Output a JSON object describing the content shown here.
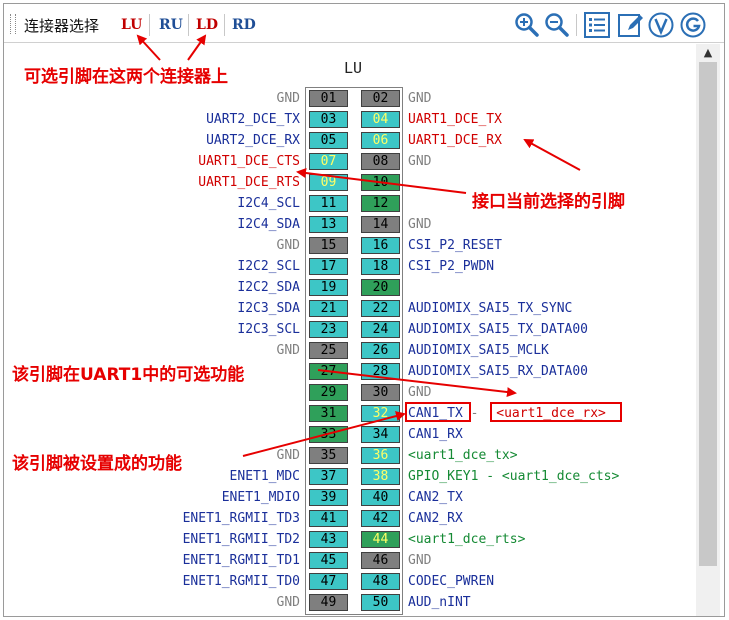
{
  "toolbar": {
    "label": "连接器选择",
    "connectors": [
      {
        "label": "LU",
        "color": "#c00000"
      },
      {
        "label": "RU",
        "color": "#1f4e96"
      },
      {
        "label": "LD",
        "color": "#c00000"
      },
      {
        "label": "RD",
        "color": "#1f4e96"
      }
    ],
    "icons": [
      "zoom-in-icon",
      "zoom-out-icon",
      "list-icon",
      "edit-icon",
      "v-circle-icon",
      "g-circle-icon"
    ]
  },
  "connector_title": "LU",
  "rows": [
    {
      "ln": "01",
      "lc": "gray",
      "lname": "GND",
      "lcolor": "gray",
      "rn": "02",
      "rc": "gray",
      "rname": "GND",
      "rcolor": "gray"
    },
    {
      "ln": "03",
      "lc": "teal",
      "lname": "UART2_DCE_TX",
      "lcolor": "blue",
      "rn": "04",
      "rc": "teal",
      "rhl": true,
      "rname": "UART1_DCE_TX",
      "rcolor": "red"
    },
    {
      "ln": "05",
      "lc": "teal",
      "lname": "UART2_DCE_RX",
      "lcolor": "blue",
      "rn": "06",
      "rc": "teal",
      "rhl": true,
      "rname": "UART1_DCE_RX",
      "rcolor": "red"
    },
    {
      "ln": "07",
      "lc": "teal",
      "lhl": true,
      "lname": "UART1_DCE_CTS",
      "lcolor": "red",
      "rn": "08",
      "rc": "gray",
      "rname": "GND",
      "rcolor": "gray"
    },
    {
      "ln": "09",
      "lc": "teal",
      "lhl": true,
      "lname": "UART1_DCE_RTS",
      "lcolor": "red",
      "rn": "10",
      "rc": "green",
      "rname": "",
      "rcolor": "gray"
    },
    {
      "ln": "11",
      "lc": "teal",
      "lname": "I2C4_SCL",
      "lcolor": "blue",
      "rn": "12",
      "rc": "green",
      "rname": "",
      "rcolor": "gray"
    },
    {
      "ln": "13",
      "lc": "teal",
      "lname": "I2C4_SDA",
      "lcolor": "blue",
      "rn": "14",
      "rc": "gray",
      "rname": "GND",
      "rcolor": "gray"
    },
    {
      "ln": "15",
      "lc": "gray",
      "lname": "GND",
      "lcolor": "gray",
      "rn": "16",
      "rc": "teal",
      "rname": "CSI_P2_RESET",
      "rcolor": "blue"
    },
    {
      "ln": "17",
      "lc": "teal",
      "lname": "I2C2_SCL",
      "lcolor": "blue",
      "rn": "18",
      "rc": "teal",
      "rname": "CSI_P2_PWDN",
      "rcolor": "blue"
    },
    {
      "ln": "19",
      "lc": "teal",
      "lname": "I2C2_SDA",
      "lcolor": "blue",
      "rn": "20",
      "rc": "green",
      "rname": "",
      "rcolor": "gray"
    },
    {
      "ln": "21",
      "lc": "teal",
      "lname": "I2C3_SDA",
      "lcolor": "blue",
      "rn": "22",
      "rc": "teal",
      "rname": "AUDIOMIX_SAI5_TX_SYNC",
      "rcolor": "blue"
    },
    {
      "ln": "23",
      "lc": "teal",
      "lname": "I2C3_SCL",
      "lcolor": "blue",
      "rn": "24",
      "rc": "teal",
      "rname": "AUDIOMIX_SAI5_TX_DATA00",
      "rcolor": "blue"
    },
    {
      "ln": "25",
      "lc": "gray",
      "lname": "GND",
      "lcolor": "gray",
      "rn": "26",
      "rc": "teal",
      "rname": "AUDIOMIX_SAI5_MCLK",
      "rcolor": "blue"
    },
    {
      "ln": "27",
      "lc": "green",
      "lname": "",
      "lcolor": "gray",
      "rn": "28",
      "rc": "teal",
      "rname": "AUDIOMIX_SAI5_RX_DATA00",
      "rcolor": "blue"
    },
    {
      "ln": "29",
      "lc": "green",
      "lname": "",
      "lcolor": "gray",
      "rn": "30",
      "rc": "gray",
      "rname": "GND",
      "rcolor": "gray"
    },
    {
      "ln": "31",
      "lc": "green",
      "lname": "",
      "lcolor": "gray",
      "rn": "32",
      "rc": "teal",
      "rhl": true,
      "rname": "CAN1_TX",
      "rcolor": "blue",
      "rsuffix": " - ",
      "roption": "<uart1_dce_rx>",
      "roptcolor": "red"
    },
    {
      "ln": "33",
      "lc": "green",
      "lname": "",
      "lcolor": "gray",
      "rn": "34",
      "rc": "teal",
      "rname": "CAN1_RX",
      "rcolor": "blue"
    },
    {
      "ln": "35",
      "lc": "gray",
      "lname": "GND",
      "lcolor": "gray",
      "rn": "36",
      "rc": "teal",
      "rhl": true,
      "rname": "<uart1_dce_tx>",
      "rcolor": "green"
    },
    {
      "ln": "37",
      "lc": "teal",
      "lname": "ENET1_MDC",
      "lcolor": "blue",
      "rn": "38",
      "rc": "teal",
      "rhl": true,
      "rname": "GPIO_KEY1 - <uart1_dce_cts>",
      "rcolor": "green"
    },
    {
      "ln": "39",
      "lc": "teal",
      "lname": "ENET1_MDIO",
      "lcolor": "blue",
      "rn": "40",
      "rc": "teal",
      "rname": "CAN2_TX",
      "rcolor": "blue"
    },
    {
      "ln": "41",
      "lc": "teal",
      "lname": "ENET1_RGMII_TD3",
      "lcolor": "blue",
      "rn": "42",
      "rc": "teal",
      "rname": "CAN2_RX",
      "rcolor": "blue"
    },
    {
      "ln": "43",
      "lc": "teal",
      "lname": "ENET1_RGMII_TD2",
      "lcolor": "blue",
      "rn": "44",
      "rc": "green",
      "rhl": true,
      "rname": "<uart1_dce_rts>",
      "rcolor": "green"
    },
    {
      "ln": "45",
      "lc": "teal",
      "lname": "ENET1_RGMII_TD1",
      "lcolor": "blue",
      "rn": "46",
      "rc": "gray",
      "rname": "GND",
      "rcolor": "gray"
    },
    {
      "ln": "47",
      "lc": "teal",
      "lname": "ENET1_RGMII_TD0",
      "lcolor": "blue",
      "rn": "48",
      "rc": "teal",
      "rname": "CODEC_PWREN",
      "rcolor": "blue"
    },
    {
      "ln": "49",
      "lc": "gray",
      "lname": "GND",
      "lcolor": "gray",
      "rn": "50",
      "rc": "teal",
      "rname": "AUD_nINT",
      "rcolor": "blue"
    }
  ],
  "annotations": {
    "selectable_connectors": "可选引脚在这两个连接器上",
    "current_pin": "接口当前选择的引脚",
    "uart1_options": "该引脚在UART1中的可选功能",
    "set_function": "该引脚被设置成的功能"
  },
  "colors": {
    "accent_red": "#e60000",
    "pin_teal": "#3dc6c6",
    "pin_green": "#2fa05a",
    "pin_gray": "#7f7f7f"
  }
}
